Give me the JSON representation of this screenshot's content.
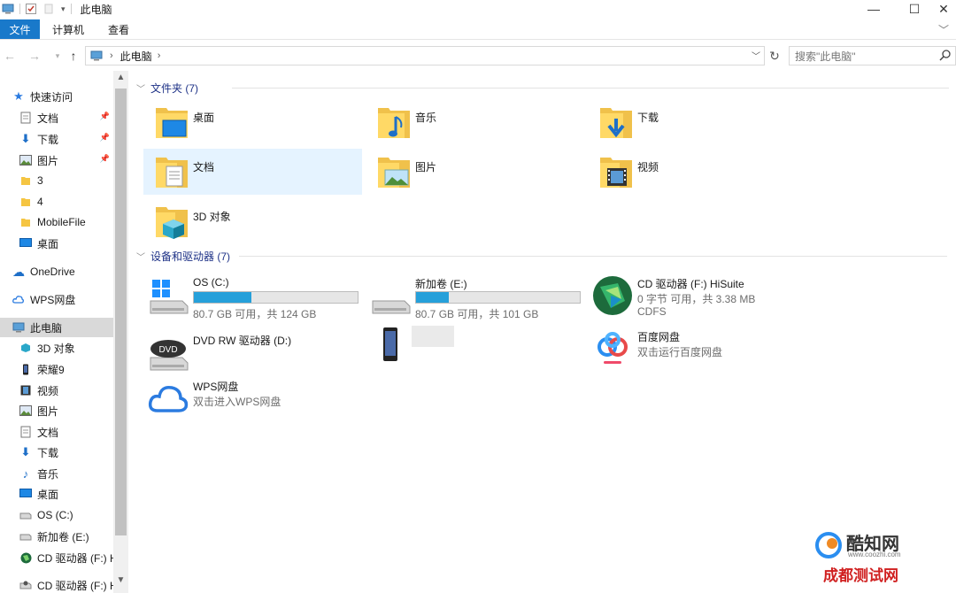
{
  "window": {
    "title": "此电脑",
    "controls": {
      "minimize": "—",
      "maximize": "☐",
      "close": "✕"
    }
  },
  "ribbon": {
    "tabs": [
      "文件",
      "计算机",
      "查看"
    ]
  },
  "address": {
    "crumb": "此电脑",
    "search_placeholder": "搜索\"此电脑\""
  },
  "sidebar": {
    "items": [
      {
        "label": "快速访问",
        "icon": "star-icon",
        "pinned": false
      },
      {
        "label": "文档",
        "icon": "document-icon",
        "pinned": true
      },
      {
        "label": "下载",
        "icon": "download-icon",
        "pinned": true
      },
      {
        "label": "图片",
        "icon": "picture-icon",
        "pinned": true
      },
      {
        "label": "3",
        "icon": "folder-icon",
        "pinned": false
      },
      {
        "label": "4",
        "icon": "folder-icon",
        "pinned": false
      },
      {
        "label": "MobileFile",
        "icon": "folder-icon",
        "pinned": false
      },
      {
        "label": "桌面",
        "icon": "desktop-icon",
        "pinned": false
      },
      {
        "label": "OneDrive",
        "icon": "cloud-icon",
        "pinned": false
      },
      {
        "label": "WPS网盘",
        "icon": "wps-cloud-icon",
        "pinned": false
      },
      {
        "label": "此电脑",
        "icon": "computer-icon",
        "pinned": false
      },
      {
        "label": "3D 对象",
        "icon": "cube-icon",
        "pinned": false
      },
      {
        "label": "荣耀9",
        "icon": "phone-icon",
        "pinned": false
      },
      {
        "label": "视频",
        "icon": "video-icon",
        "pinned": false
      },
      {
        "label": "图片",
        "icon": "picture-icon",
        "pinned": false
      },
      {
        "label": "文档",
        "icon": "document-icon",
        "pinned": false
      },
      {
        "label": "下载",
        "icon": "download-icon",
        "pinned": false
      },
      {
        "label": "音乐",
        "icon": "music-icon",
        "pinned": false
      },
      {
        "label": "桌面",
        "icon": "desktop-icon",
        "pinned": false
      },
      {
        "label": "OS (C:)",
        "icon": "drive-icon",
        "pinned": false
      },
      {
        "label": "新加卷 (E:)",
        "icon": "drive-icon",
        "pinned": false
      },
      {
        "label": "CD 驱动器 (F:) H",
        "icon": "hisuite-icon",
        "pinned": false
      },
      {
        "label": "CD 驱动器 (F:) Hi",
        "icon": "cd-drive-icon",
        "pinned": false
      }
    ]
  },
  "folders": {
    "header": "文件夹 (7)",
    "items": [
      {
        "name": "桌面",
        "icon": "desktop-folder-icon"
      },
      {
        "name": "音乐",
        "icon": "music-folder-icon"
      },
      {
        "name": "下载",
        "icon": "download-folder-icon"
      },
      {
        "name": "文档",
        "icon": "document-folder-icon"
      },
      {
        "name": "图片",
        "icon": "picture-folder-icon"
      },
      {
        "name": "视频",
        "icon": "video-folder-icon"
      },
      {
        "name": "3D 对象",
        "icon": "3d-folder-icon"
      }
    ]
  },
  "devices": {
    "header": "设备和驱动器 (7)",
    "os_c": {
      "name": "OS (C:)",
      "detail": "80.7 GB 可用，共 124 GB",
      "used_fraction": 0.35
    },
    "new_e": {
      "name": "新加卷 (E:)",
      "detail": "80.7 GB 可用，共 101 GB",
      "used_fraction": 0.2
    },
    "cd_f": {
      "name": "CD 驱动器 (F:) HiSuite",
      "detail": "0 字节 可用，共 3.38 MB",
      "fs": "CDFS"
    },
    "dvd_d": {
      "name": "DVD RW 驱动器 (D:)"
    },
    "phone": {
      "name": ""
    },
    "baidu": {
      "name": "百度网盘",
      "detail": "双击运行百度网盘"
    },
    "wps": {
      "name": "WPS网盘",
      "detail": "双击进入WPS网盘"
    }
  },
  "watermark": {
    "top": "酷知网",
    "top_sub": "www.coozhi.com",
    "bottom": "成都测试网"
  }
}
